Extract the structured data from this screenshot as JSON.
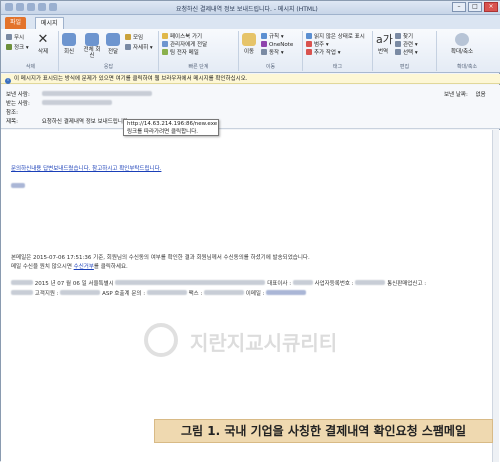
{
  "window": {
    "title": "요청하신 결제내역 정보 보내드립니다. - 메시지 (HTML)"
  },
  "tabs": {
    "file": "파일",
    "message": "메시지"
  },
  "ribbon": {
    "groups": [
      {
        "caption": "삭제",
        "items": [
          "무시",
          "정크 ▾",
          "삭제"
        ]
      },
      {
        "caption": "응답",
        "items": [
          "회신",
          "전체 회신",
          "전달",
          "모임",
          "자세히 ▾"
        ]
      },
      {
        "caption": "빠른 단계",
        "items": [
          "페이스북 가기",
          "관리자에게 전달",
          "팀 전자 메일"
        ]
      },
      {
        "caption": "이동",
        "items": [
          "이동",
          "규칙 ▾",
          "OneNote",
          "동작 ▾"
        ]
      },
      {
        "caption": "태그",
        "items": [
          "읽지 않은 상태로 표시",
          "범주 ▾",
          "추가 작업 ▾"
        ]
      },
      {
        "caption": "편집",
        "items": [
          "번역",
          "찾기",
          "관련 ▾",
          "선택 ▾"
        ]
      },
      {
        "caption": "확대/축소",
        "items": [
          "확대/축소"
        ]
      }
    ]
  },
  "infobar": {
    "text": "이 메시지가 표시되는 방식에 문제가 있으면 여기를 클릭하여 웹 브라우저에서 메시지를 확인하십시오."
  },
  "header": {
    "from_label": "보낸 사람:",
    "to_label": "받는 사람:",
    "cc_label": "참조:",
    "subject_label": "제목:",
    "subject_value": "요청하신 결제내역 정보 보내드립니다.",
    "sent_label": "보낸 날짜:",
    "sent_value": "없음"
  },
  "tooltip": {
    "url": "http://14.63.214.196:86/new.exe",
    "hint": "링크를 따라가려면 클릭합니다."
  },
  "body": {
    "link_line": "문의하신내용 답변보내드렸습니다. 참고하시고 확인부탁드립니다.",
    "footer_line1": "본메일은 2015-07-06 17:51:36 기준, 회원님의 수신동의 여부를 확인한 결과 회원님께서 수신동의를 하셨기에 발송되었습니다.",
    "footer_line2_pre": "메일 수신을 원치 않으시면",
    "footer_line2_link": "수신거부",
    "footer_line2_post": "를 클릭하세요.",
    "footer_line3": "2015 년 07 월 06 일 서울특별시",
    "footer_line3_mid": "대표이사 :",
    "footer_line3_end": "사업자등록번호 :",
    "footer_line3_tail": "통신판매업신고 :",
    "footer_line4_a": "고객지원 :",
    "footer_line4_b": "ASP 호출계 문의 :",
    "footer_line4_c": "팩스 :",
    "footer_line4_d": "이메일 :"
  },
  "watermark": {
    "text": "지란지교시큐리티"
  },
  "caption": {
    "text": "그림 1. 국내 기업을 사칭한 결제내역 확인요청 스팸메일"
  }
}
